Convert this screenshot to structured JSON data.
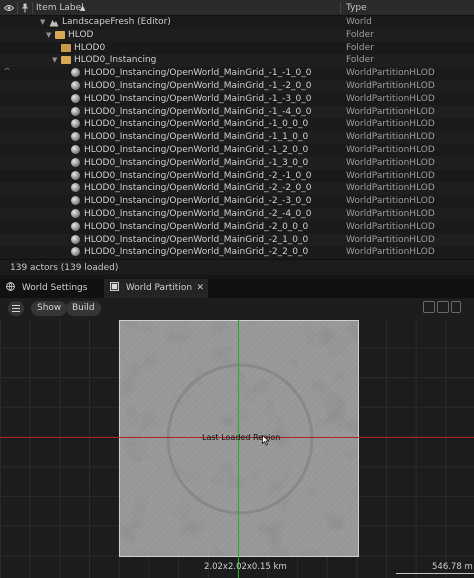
{
  "outliner": {
    "header": {
      "sort_label": "Item Label",
      "sort_arrow": "▲",
      "type_label": "Type"
    },
    "rows": [
      {
        "label": "LandscapeFresh (Editor)",
        "type": "World",
        "indent": 0,
        "icon": "world-icon",
        "expanded": true
      },
      {
        "label": "HLOD",
        "type": "Folder",
        "indent": 1,
        "icon": "folder-open-icon",
        "expanded": true
      },
      {
        "label": "HLOD0",
        "type": "Folder",
        "indent": 2,
        "icon": "folder-icon",
        "expanded": false
      },
      {
        "label": "HLOD0_Instancing",
        "type": "Folder",
        "indent": 2,
        "icon": "folder-open-icon",
        "expanded": true
      },
      {
        "label": "HLOD0_Instancing/OpenWorld_MainGrid_-1_-1_0_0",
        "type": "WorldPartitionHLOD",
        "indent": 3,
        "icon": "sphere-icon"
      },
      {
        "label": "HLOD0_Instancing/OpenWorld_MainGrid_-1_-2_0_0",
        "type": "WorldPartitionHLOD",
        "indent": 3,
        "icon": "sphere-icon"
      },
      {
        "label": "HLOD0_Instancing/OpenWorld_MainGrid_-1_-3_0_0",
        "type": "WorldPartitionHLOD",
        "indent": 3,
        "icon": "sphere-icon"
      },
      {
        "label": "HLOD0_Instancing/OpenWorld_MainGrid_-1_-4_0_0",
        "type": "WorldPartitionHLOD",
        "indent": 3,
        "icon": "sphere-icon"
      },
      {
        "label": "HLOD0_Instancing/OpenWorld_MainGrid_-1_0_0_0",
        "type": "WorldPartitionHLOD",
        "indent": 3,
        "icon": "sphere-icon"
      },
      {
        "label": "HLOD0_Instancing/OpenWorld_MainGrid_-1_1_0_0",
        "type": "WorldPartitionHLOD",
        "indent": 3,
        "icon": "sphere-icon"
      },
      {
        "label": "HLOD0_Instancing/OpenWorld_MainGrid_-1_2_0_0",
        "type": "WorldPartitionHLOD",
        "indent": 3,
        "icon": "sphere-icon"
      },
      {
        "label": "HLOD0_Instancing/OpenWorld_MainGrid_-1_3_0_0",
        "type": "WorldPartitionHLOD",
        "indent": 3,
        "icon": "sphere-icon"
      },
      {
        "label": "HLOD0_Instancing/OpenWorld_MainGrid_-2_-1_0_0",
        "type": "WorldPartitionHLOD",
        "indent": 3,
        "icon": "sphere-icon"
      },
      {
        "label": "HLOD0_Instancing/OpenWorld_MainGrid_-2_-2_0_0",
        "type": "WorldPartitionHLOD",
        "indent": 3,
        "icon": "sphere-icon"
      },
      {
        "label": "HLOD0_Instancing/OpenWorld_MainGrid_-2_-3_0_0",
        "type": "WorldPartitionHLOD",
        "indent": 3,
        "icon": "sphere-icon"
      },
      {
        "label": "HLOD0_Instancing/OpenWorld_MainGrid_-2_-4_0_0",
        "type": "WorldPartitionHLOD",
        "indent": 3,
        "icon": "sphere-icon"
      },
      {
        "label": "HLOD0_Instancing/OpenWorld_MainGrid_-2_0_0_0",
        "type": "WorldPartitionHLOD",
        "indent": 3,
        "icon": "sphere-icon"
      },
      {
        "label": "HLOD0_Instancing/OpenWorld_MainGrid_-2_1_0_0",
        "type": "WorldPartitionHLOD",
        "indent": 3,
        "icon": "sphere-icon"
      },
      {
        "label": "HLOD0_Instancing/OpenWorld_MainGrid_-2_2_0_0",
        "type": "WorldPartitionHLOD",
        "indent": 3,
        "icon": "sphere-icon"
      }
    ],
    "status": "139 actors (139 loaded)"
  },
  "tabs": [
    {
      "label": "World Settings",
      "icon": "globe-icon",
      "active": false
    },
    {
      "label": "World Partition",
      "icon": "map-icon",
      "active": true,
      "close": "✕"
    }
  ],
  "toolbar": {
    "show_label": "Show",
    "build_label": "Build"
  },
  "viewport": {
    "region_label": "Last Loaded Region",
    "size_label": "2.02x2.02x0.15 km",
    "distance_label": "546.78 m"
  },
  "colors": {
    "x_axis": "#b81f1f",
    "y_axis": "#1fb21f",
    "folder": "#c79a4d",
    "background": "#1a1a1a"
  }
}
